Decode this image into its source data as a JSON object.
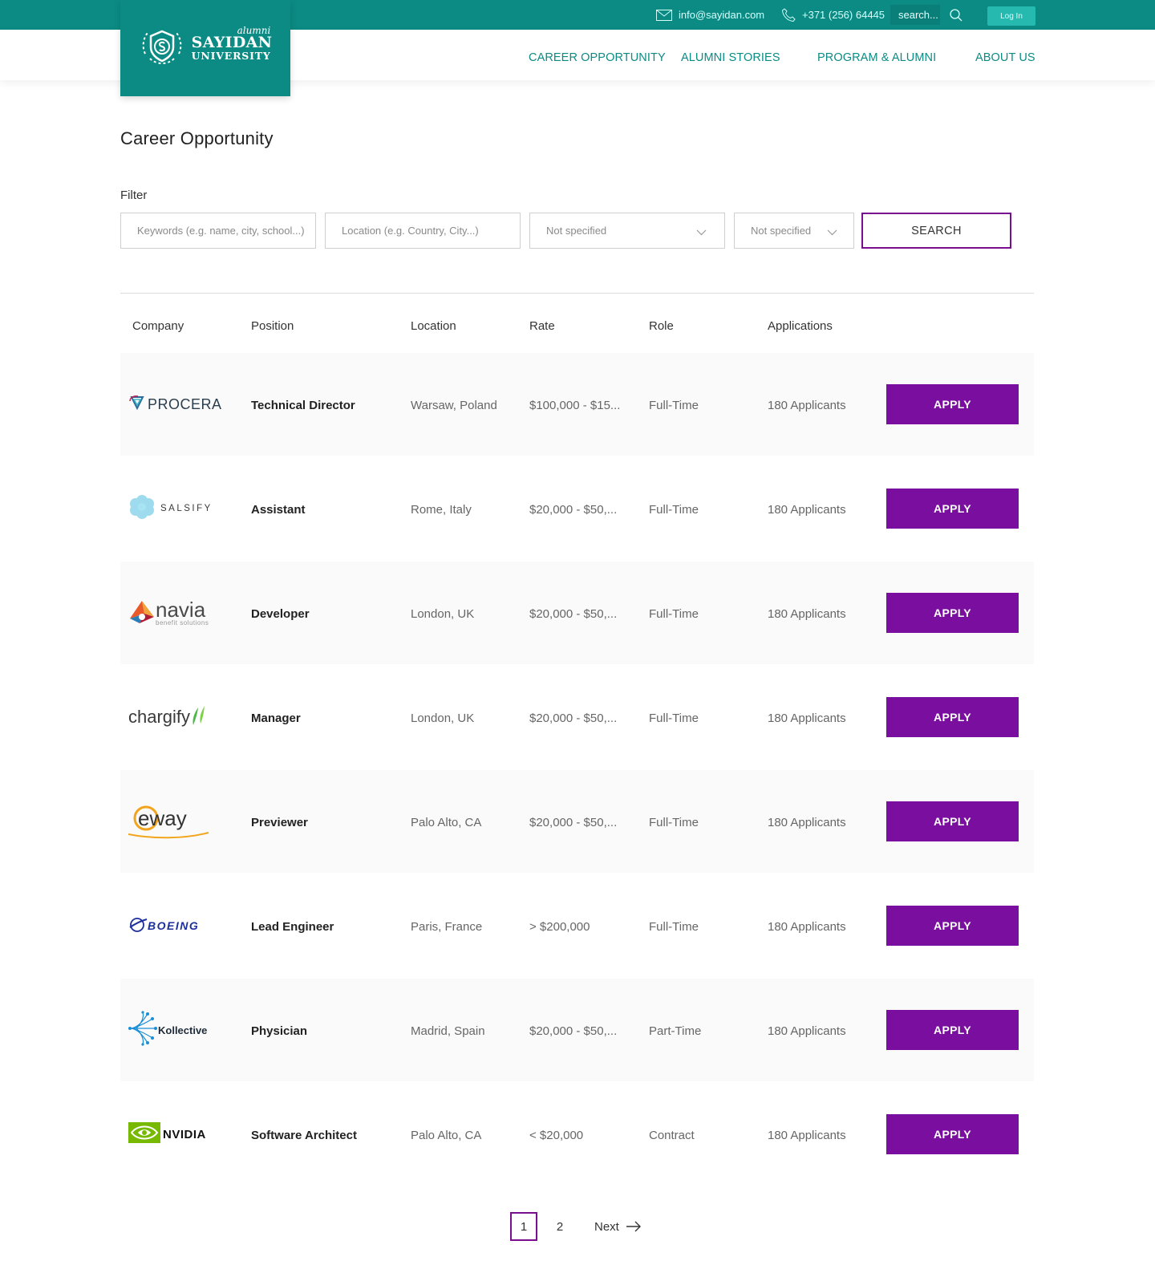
{
  "topbar": {
    "email": "info@sayidan.com",
    "phone": "+371 (256) 64445",
    "search_placeholder": "search...",
    "login_label": "Log In"
  },
  "logo": {
    "alumni": "alumni",
    "name": "SAYIDAN",
    "university": "UNIVERSITY"
  },
  "nav": {
    "items": [
      {
        "label": "CAREER OPPORTUNITY"
      },
      {
        "label": "ALUMNI STORIES"
      },
      {
        "label": "PROGRAM & ALUMNI"
      },
      {
        "label": "ABOUT US"
      }
    ]
  },
  "page": {
    "title": "Career Opportunity",
    "filter_label": "Filter"
  },
  "filters": {
    "keywords_placeholder": "Keywords (e.g. name, city, school...)",
    "location_placeholder": "Location (e.g. Country, City...)",
    "select1_value": "Not specified",
    "select2_value": "Not specified",
    "search_label": "SEARCH"
  },
  "table": {
    "headers": {
      "company": "Company",
      "position": "Position",
      "location": "Location",
      "rate": "Rate",
      "role": "Role",
      "applications": "Applications"
    },
    "apply_label": "APPLY",
    "rows": [
      {
        "company": "PROCERA",
        "position": "Technical Director",
        "location": "Warsaw, Poland",
        "rate": "$100,000 - $15...",
        "role": "Full-Time",
        "applications": "180 Applicants"
      },
      {
        "company": "SALSIFY",
        "position": "Assistant",
        "location": "Rome, Italy",
        "rate": "$20,000 - $50,...",
        "role": "Full-Time",
        "applications": "180 Applicants"
      },
      {
        "company": "navia",
        "company_sub": "benefit solutions",
        "position": "Developer",
        "location": "London, UK",
        "rate": "$20,000 - $50,...",
        "role": "Full-Time",
        "applications": "180 Applicants"
      },
      {
        "company": "chargify",
        "position": "Manager",
        "location": "London, UK",
        "rate": "$20,000 - $50,...",
        "role": "Full-Time",
        "applications": "180 Applicants"
      },
      {
        "company": "eway",
        "position": "Previewer",
        "location": "Palo Alto, CA",
        "rate": "$20,000 - $50,...",
        "role": "Full-Time",
        "applications": "180 Applicants"
      },
      {
        "company": "BOEING",
        "position": "Lead Engineer",
        "location": "Paris, France",
        "rate": "> $200,000",
        "role": "Full-Time",
        "applications": "180 Applicants"
      },
      {
        "company": "Kollective",
        "position": "Physician",
        "location": "Madrid, Spain",
        "rate": "$20,000 - $50,...",
        "role": "Part-Time",
        "applications": "180 Applicants"
      },
      {
        "company": "NVIDIA",
        "position": "Software Architect",
        "location": "Palo Alto, CA",
        "rate": "< $20,000",
        "role": "Contract",
        "applications": "180 Applicants"
      }
    ]
  },
  "pagination": {
    "pages": [
      "1",
      "2"
    ],
    "current": "1",
    "next_label": "Next"
  },
  "colors": {
    "teal": "#0b8b84",
    "purple": "#7a0e9e"
  }
}
